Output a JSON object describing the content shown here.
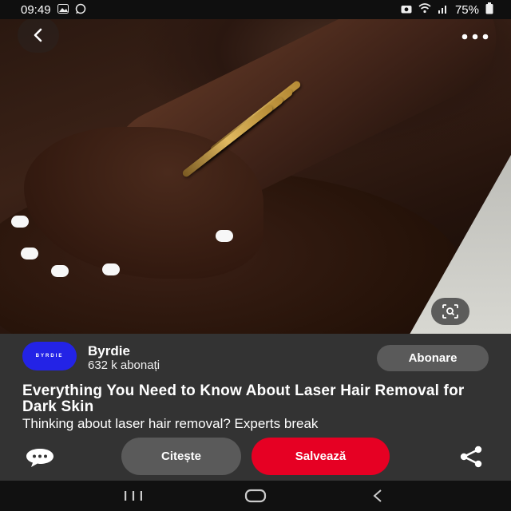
{
  "status_bar": {
    "time": "09:49",
    "battery": "75%"
  },
  "pin": {
    "creator": {
      "avatar_text": "BYRDIE",
      "name": "Byrdie",
      "followers": "632 k abonați"
    },
    "subscribe_label": "Abonare",
    "title": "Everything You Need to Know About Laser Hair Removal for Dark Skin",
    "description": "Thinking about laser hair removal? Experts break",
    "read_label": "Citește",
    "save_label": "Salvează"
  },
  "colors": {
    "save_button": "#e60023",
    "avatar_bg": "#2323e6",
    "sheet_bg": "#333333",
    "secondary_button": "#5a5a5a"
  },
  "icons": {
    "back": "chevron-left-icon",
    "more": "more-horizontal-icon",
    "lens": "visual-search-icon",
    "comment": "comment-icon",
    "share": "share-icon"
  }
}
